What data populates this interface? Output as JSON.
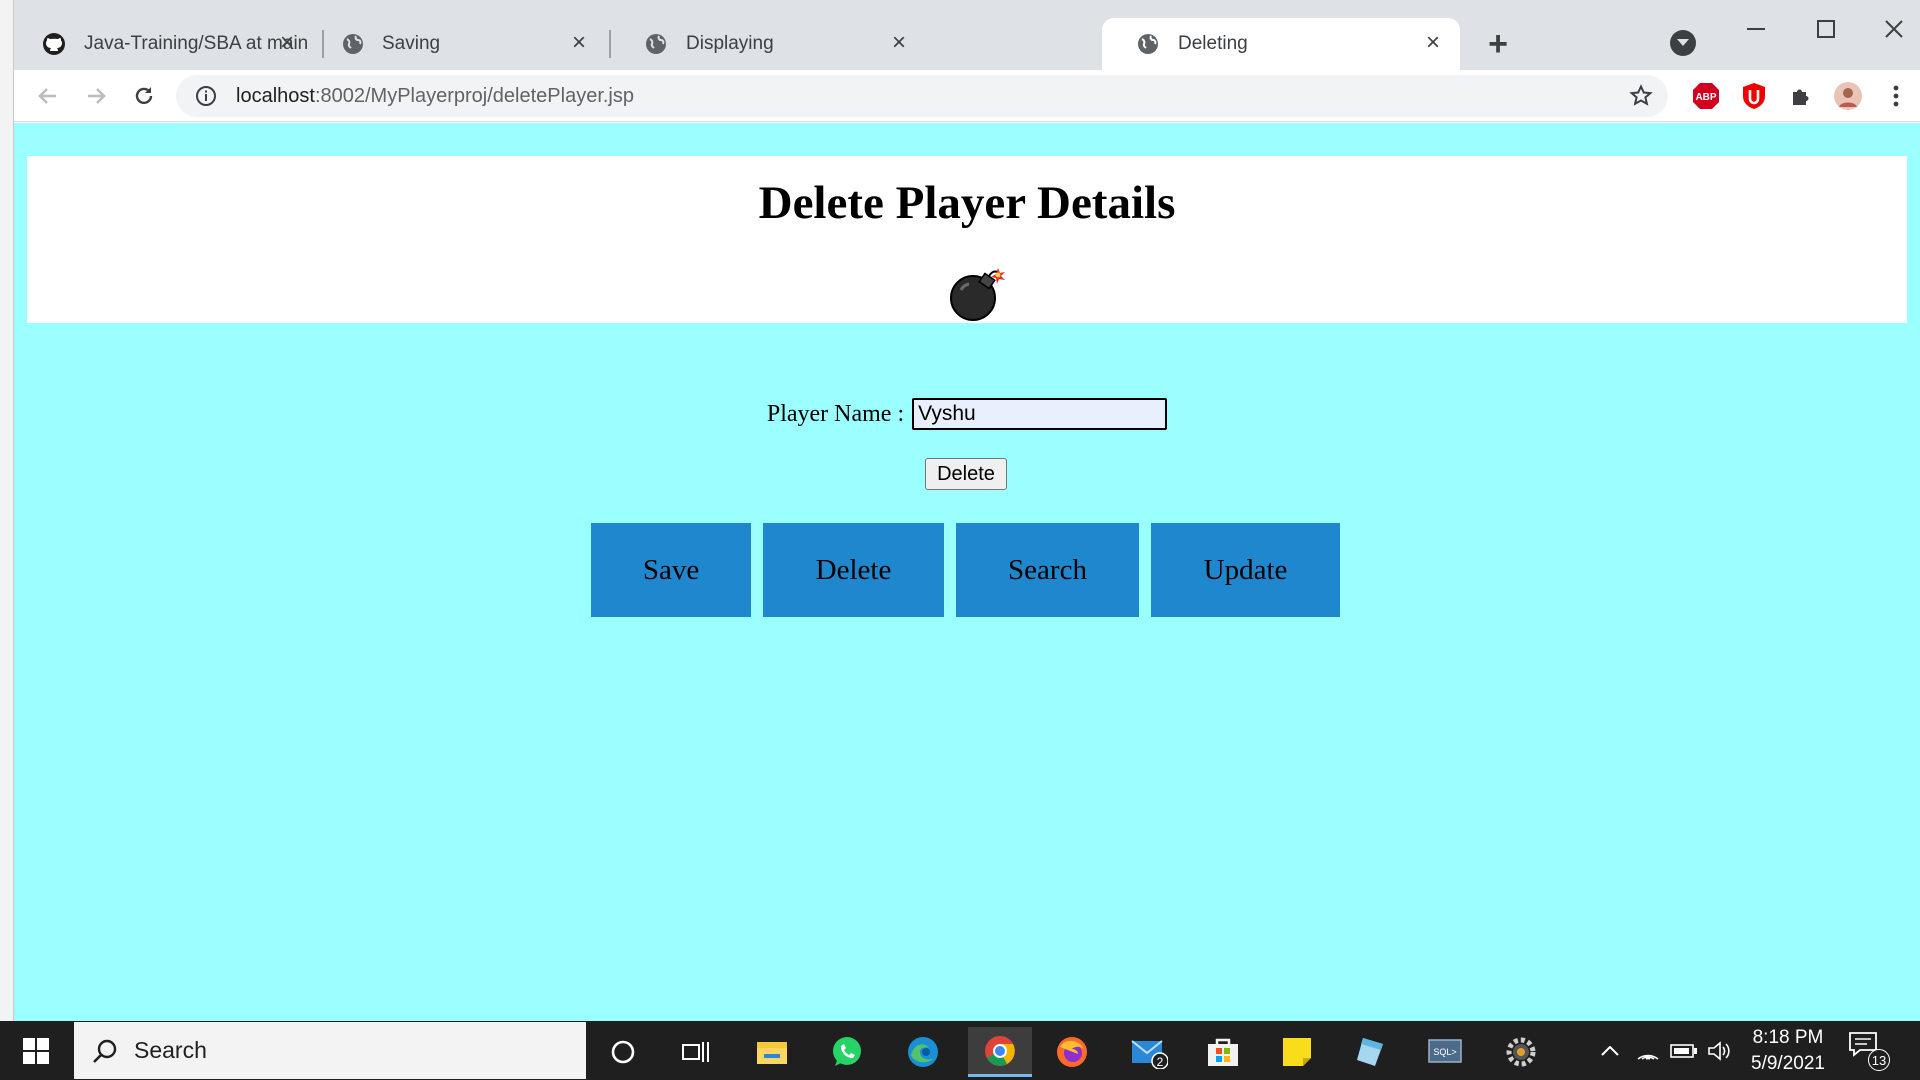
{
  "browser": {
    "tabs": [
      {
        "title": "Java-Training/SBA at main · ragav",
        "icon": "github-icon"
      },
      {
        "title": "Saving",
        "icon": "globe-icon"
      },
      {
        "title": "Displaying",
        "icon": "globe-icon"
      },
      {
        "title": "Deleting",
        "icon": "globe-icon",
        "active": true
      }
    ],
    "url_host": "localhost",
    "url_rest": ":8002/MyPlayerproj/deletePlayer.jsp"
  },
  "page": {
    "title": "Delete Player Details",
    "player_label": "Player Name :",
    "player_value": "Vyshu",
    "delete_button": "Delete",
    "nav": [
      "Save",
      "Delete",
      "Search",
      "Update"
    ]
  },
  "taskbar": {
    "search_placeholder": "Search",
    "mail_badge": "2",
    "time": "8:18 PM",
    "date": "5/9/2021",
    "notifications": "13"
  },
  "colors": {
    "page_bg": "#9cffff",
    "nav_button": "#1e87cd",
    "input_bg": "#e8f0fe"
  }
}
